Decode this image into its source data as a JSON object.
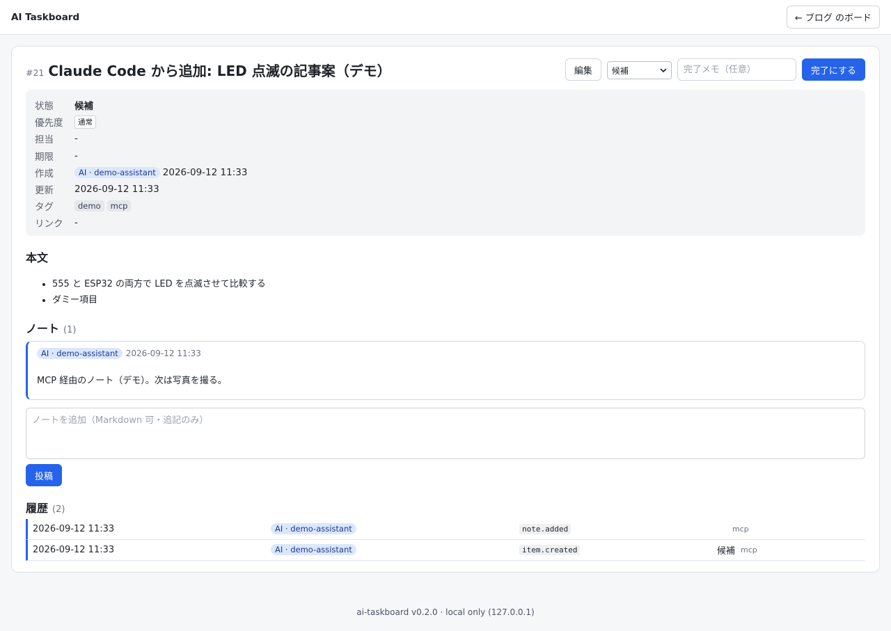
{
  "app": {
    "title": "AI Taskboard",
    "back_button": "← ブログ のボード"
  },
  "item": {
    "id": "#21",
    "title": "Claude Code から追加: LED 点滅の記事案（デモ）",
    "edit_label": "編集",
    "state_select": {
      "value": "候補"
    },
    "memo_placeholder": "完了メモ（任意）",
    "complete_label": "完了にする"
  },
  "meta": {
    "status": {
      "key": "状態",
      "value": "候補"
    },
    "priority": {
      "key": "優先度",
      "value": "通常"
    },
    "assignee": {
      "key": "担当",
      "value": "-"
    },
    "due": {
      "key": "期限",
      "value": "-"
    },
    "created": {
      "key": "作成",
      "actor": "AI · demo-assistant",
      "time": "2026-09-12 11:33"
    },
    "updated": {
      "key": "更新",
      "value": "2026-09-12 11:33"
    },
    "tags": {
      "key": "タグ",
      "items": [
        "demo",
        "mcp"
      ]
    },
    "links": {
      "key": "リンク",
      "value": "-"
    }
  },
  "body": {
    "heading": "本文",
    "items": [
      "555 と ESP32 の両方で LED を点滅させて比較する",
      "ダミー項目"
    ]
  },
  "notes": {
    "heading": "ノート",
    "count": "(1)",
    "items": [
      {
        "actor": "AI · demo-assistant",
        "time": "2026-09-12 11:33",
        "text": "MCP 経由のノート（デモ）。次は写真を撮る。"
      }
    ],
    "input_placeholder": "ノートを追加（Markdown 可・追記のみ）",
    "post_label": "投稿"
  },
  "history": {
    "heading": "履歴",
    "count": "(2)",
    "rows": [
      {
        "time": "2026-09-12 11:33",
        "actor": "AI · demo-assistant",
        "event": "note.added",
        "state": "",
        "source": "mcp"
      },
      {
        "time": "2026-09-12 11:33",
        "actor": "AI · demo-assistant",
        "event": "item.created",
        "state": "候補",
        "source": "mcp"
      }
    ]
  },
  "footer": {
    "text": "ai-taskboard v0.2.0 · local only (127.0.0.1)"
  },
  "colors": {
    "accent": "#2563eb",
    "badge_bg": "#dbe7fd",
    "page_bg": "#f6f7f9"
  }
}
